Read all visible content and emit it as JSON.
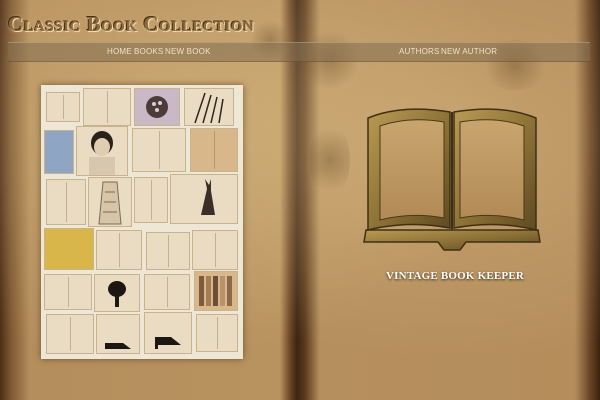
{
  "site": {
    "title": "Classic Book Collection",
    "tagline": "VINTAGE BOOK KEEPER"
  },
  "nav": {
    "left": [
      {
        "label": "HOME"
      },
      {
        "label": "BOOKS"
      },
      {
        "label": "NEW BOOK"
      }
    ],
    "right": [
      {
        "label": "AUTHORS"
      },
      {
        "label": "NEW AUTHOR"
      }
    ]
  },
  "colors": {
    "page": "#b8935f",
    "spine": "#3e2412",
    "nav_bar": "#826e50",
    "nav_text": "#efe2c6",
    "title_text": "#8a6a3e"
  },
  "icons": {
    "emblem": "open-book-icon"
  }
}
